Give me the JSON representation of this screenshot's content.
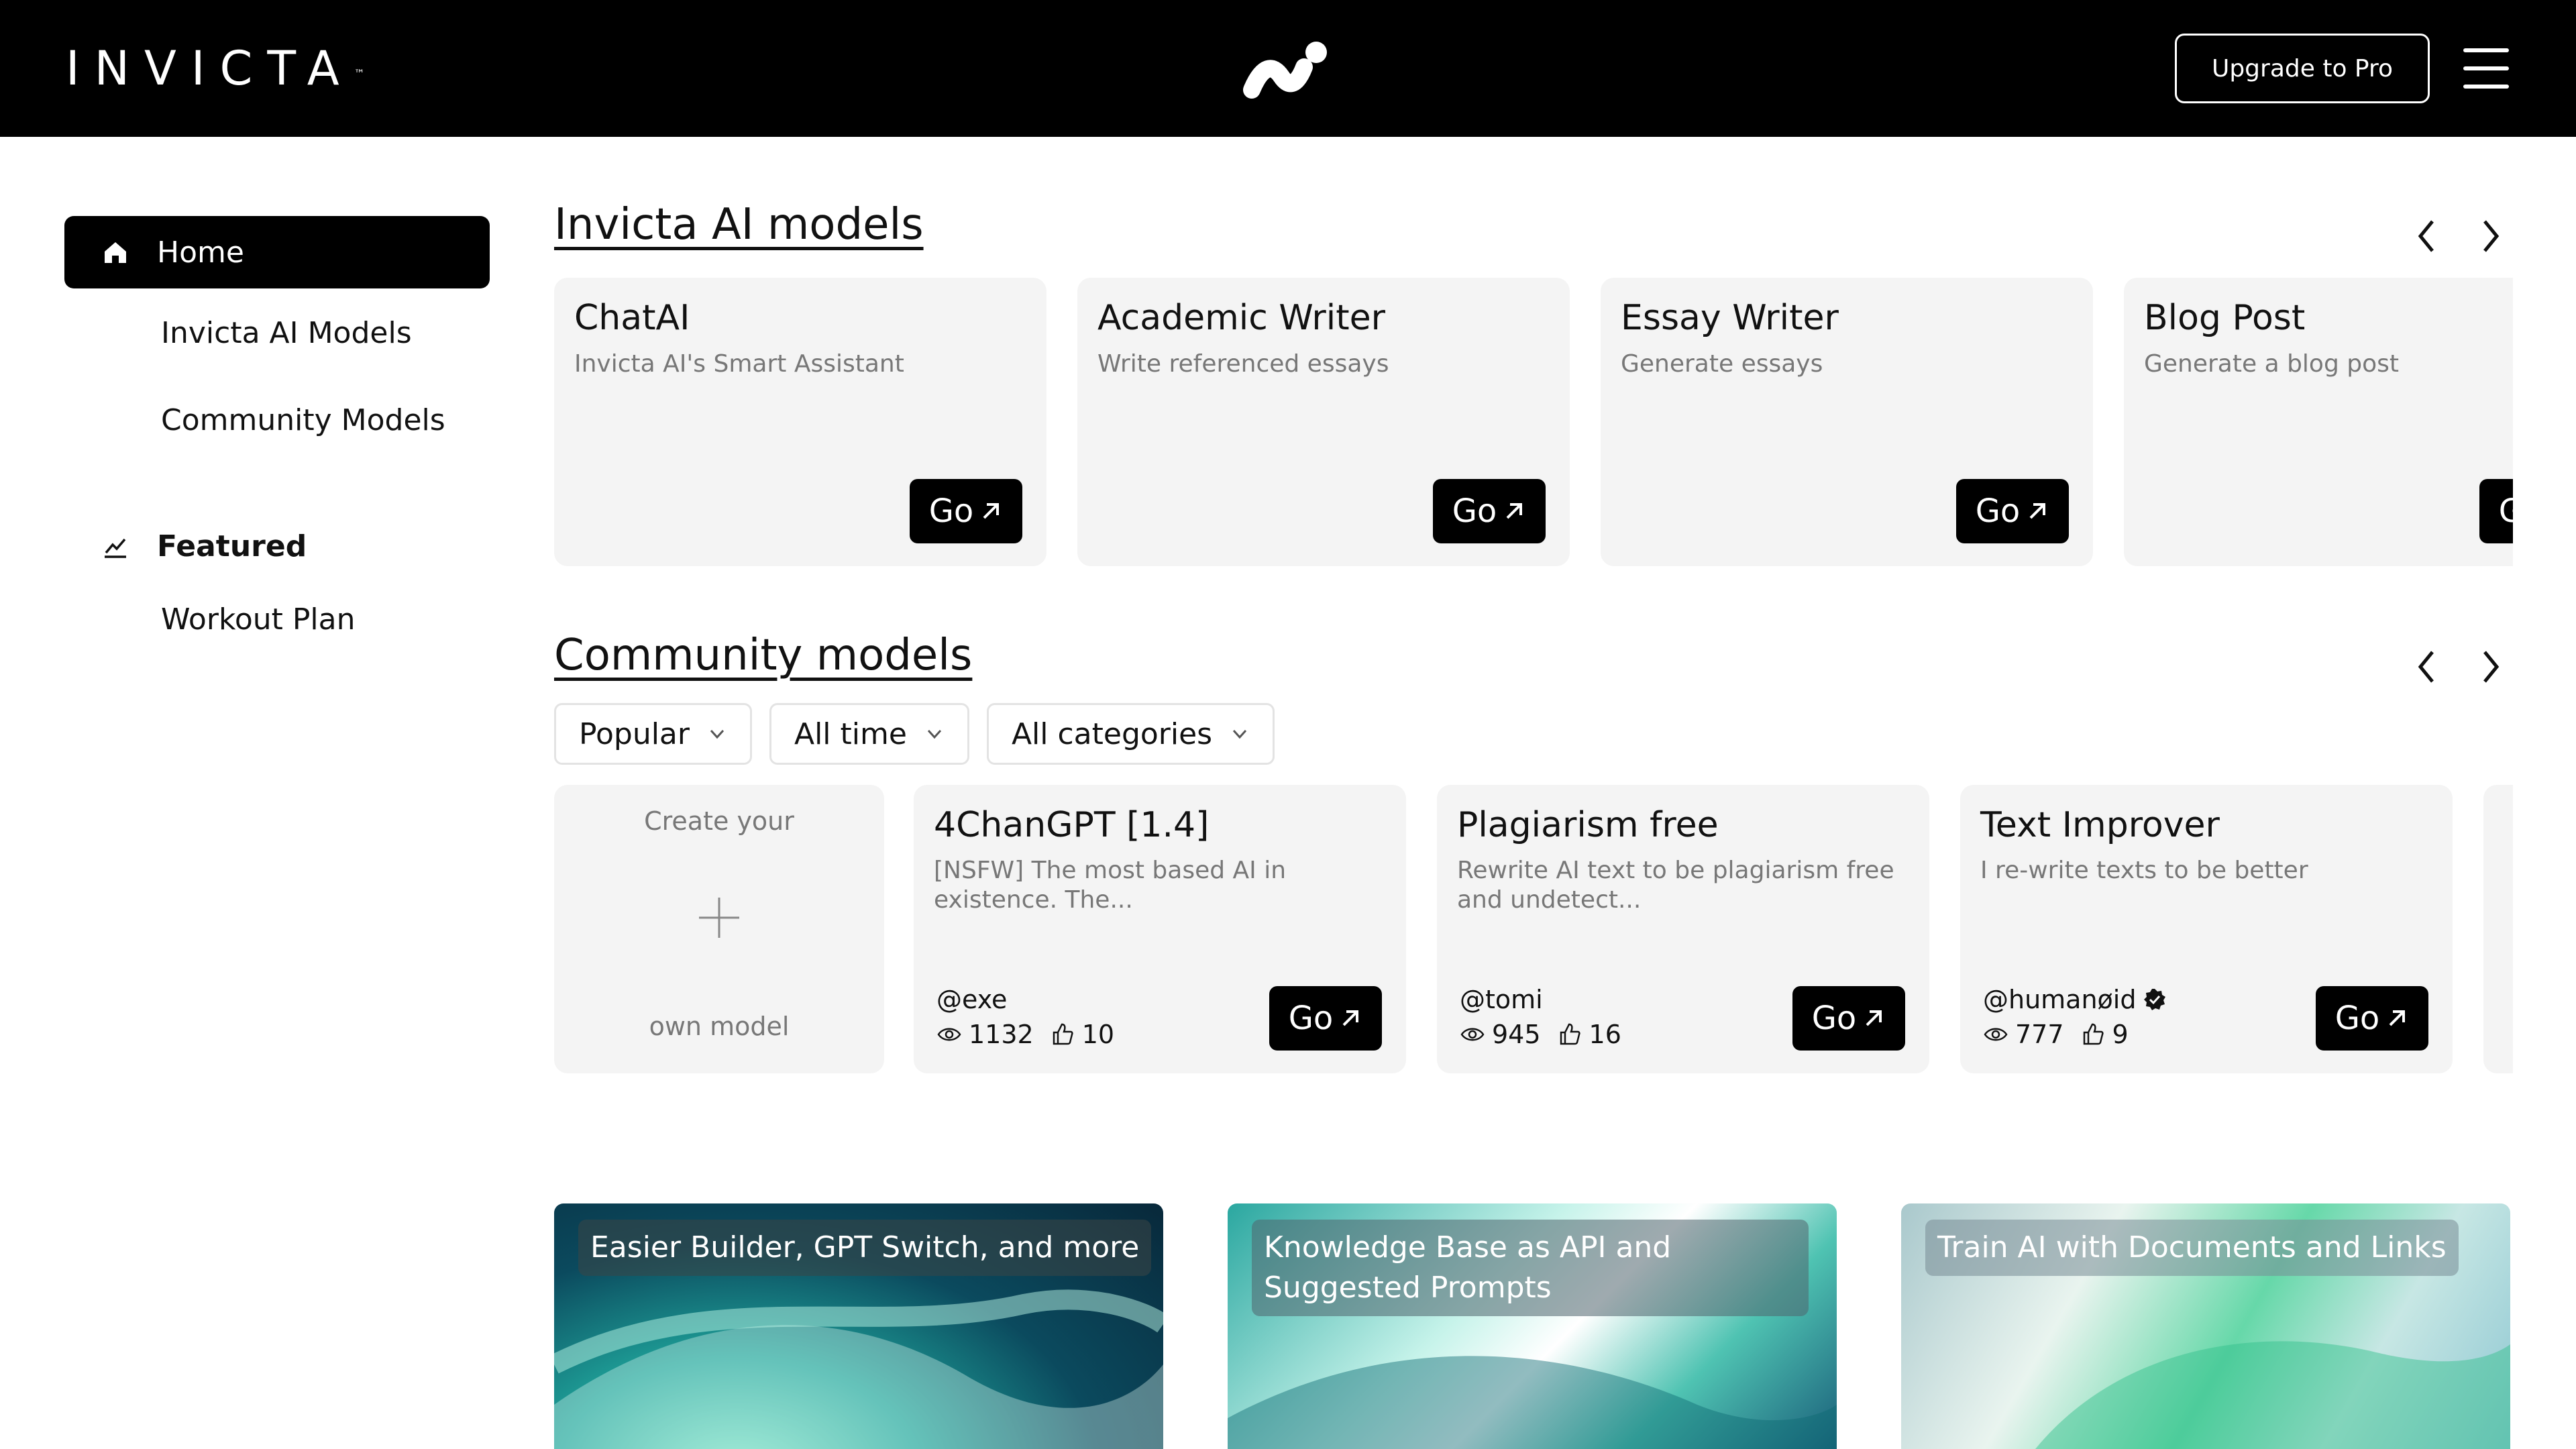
{
  "header": {
    "logo_text": "INVICTA",
    "logo_tm": "™",
    "upgrade_label": "Upgrade to Pro"
  },
  "sidebar": {
    "items": [
      {
        "label": "Home",
        "active": true,
        "icon": "home-icon"
      },
      {
        "label": "Invicta AI Models"
      },
      {
        "label": "Community Models"
      }
    ],
    "featured": {
      "label": "Featured",
      "icon": "trend-icon"
    },
    "featured_items": [
      {
        "label": "Workout Plan"
      }
    ]
  },
  "invicta_models": {
    "title": "Invicta AI models",
    "go_label": "Go",
    "cards": [
      {
        "title": "ChatAI",
        "desc": "Invicta AI's Smart Assistant"
      },
      {
        "title": "Academic Writer",
        "desc": "Write referenced essays"
      },
      {
        "title": "Essay Writer",
        "desc": "Generate essays"
      },
      {
        "title": "Blog Post",
        "desc": "Generate a blog post"
      }
    ]
  },
  "community_models": {
    "title": "Community models",
    "filters": [
      "Popular",
      "All time",
      "All categories"
    ],
    "create": {
      "top": "Create your",
      "bottom": "own model"
    },
    "go_label": "Go",
    "cards": [
      {
        "title": "4ChanGPT [1.4]",
        "desc": "[NSFW] The most based AI in existence. The...",
        "author": "@exe",
        "views": "1132",
        "likes": "10",
        "verified": false
      },
      {
        "title": "Plagiarism free",
        "desc": "Rewrite AI text to be plagiarism free and undetect...",
        "author": "@tomi",
        "views": "945",
        "likes": "16",
        "verified": false
      },
      {
        "title": "Text Improver",
        "desc": "I re-write texts to be better",
        "author": "@humanøid",
        "views": "777",
        "likes": "9",
        "verified": true
      }
    ]
  },
  "promos": [
    {
      "label": "Easier Builder, GPT Switch, and more"
    },
    {
      "label": "Knowledge Base as API and Suggested Prompts"
    },
    {
      "label": "Train AI with Documents and Links"
    }
  ],
  "colors": {
    "header_bg": "#000000",
    "card_bg": "#f4f4f4",
    "muted_text": "#777777"
  }
}
